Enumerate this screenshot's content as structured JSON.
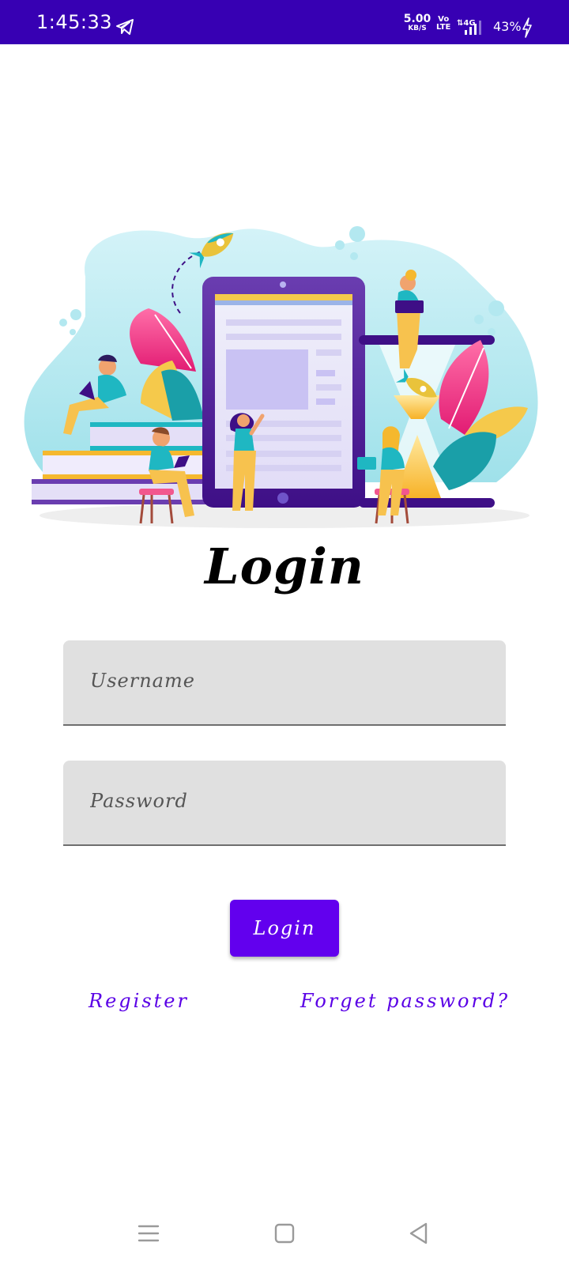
{
  "status_bar": {
    "time": "1:45:33",
    "speed_value": "5.00",
    "speed_unit": "KB/S",
    "volte_top": "Vo",
    "volte_bottom": "LTE",
    "network": "4G",
    "battery": "43%",
    "background_color": "#3700b3"
  },
  "illustration": {
    "icon": "people-learning-illustration"
  },
  "login": {
    "title": "Login",
    "username_placeholder": "Username",
    "password_placeholder": "Password",
    "button_label": "Login",
    "register_label": "Register",
    "forget_label": "Forget password?",
    "accent_color": "#6200ee"
  },
  "nav_bar": {
    "icons": [
      "menu-icon",
      "home-icon",
      "back-icon"
    ]
  }
}
